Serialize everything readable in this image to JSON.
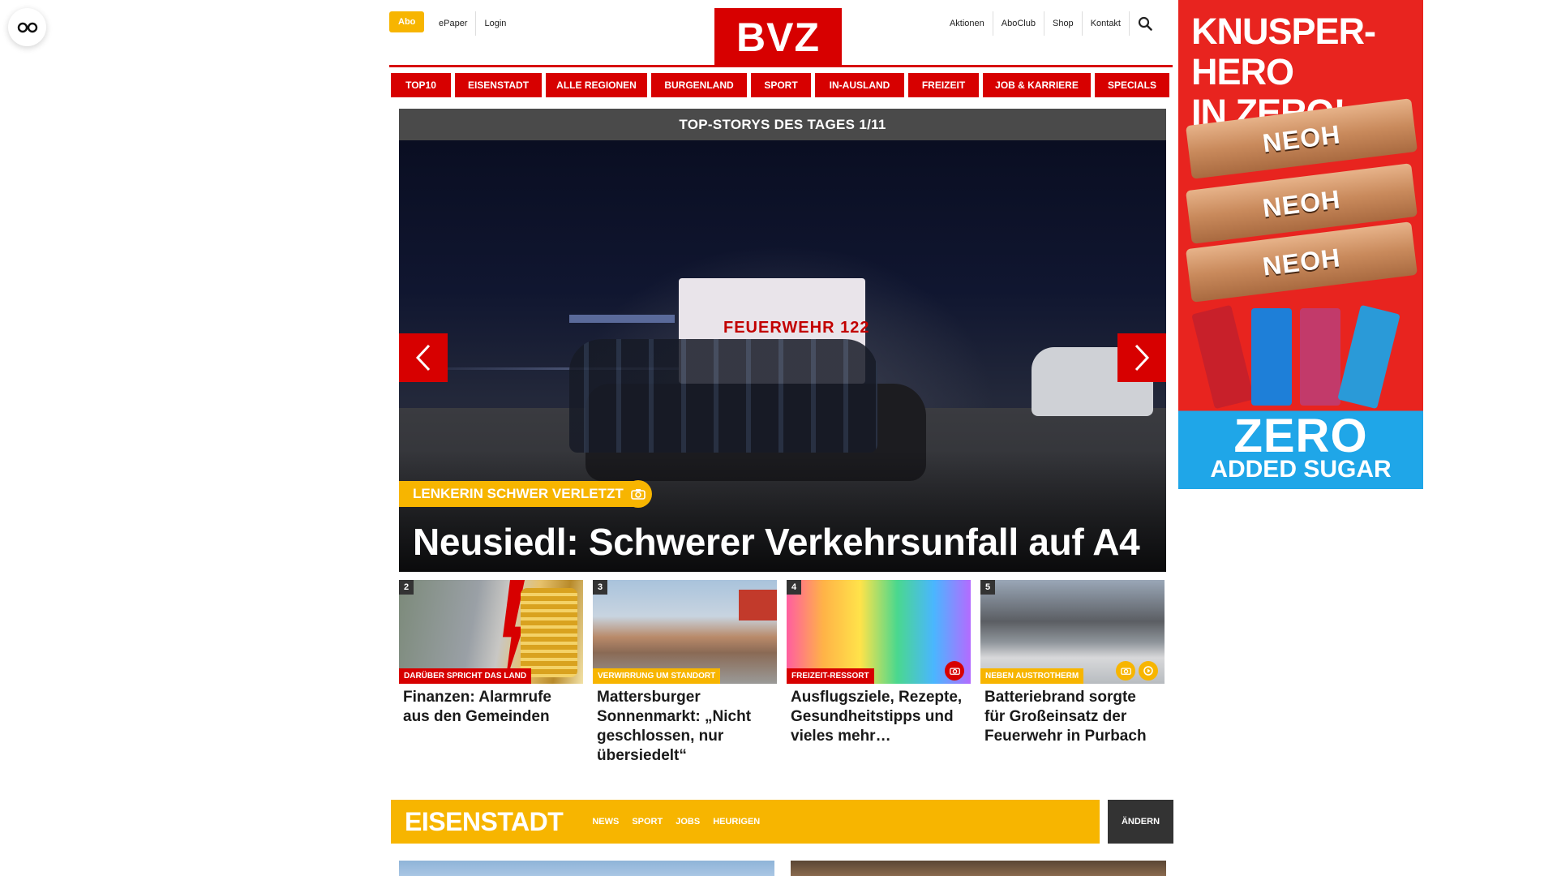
{
  "meta_nav": {
    "abo_label": "Abo",
    "left_links": [
      "ePaper",
      "Login"
    ],
    "right_links": [
      "Aktionen",
      "AboClub",
      "Shop",
      "Kontakt"
    ]
  },
  "logo": {
    "text": "BVZ"
  },
  "main_nav": [
    "TOP10",
    "EISENSTADT",
    "ALLE REGIONEN",
    "BURGENLAND",
    "SPORT",
    "IN-AUSLAND",
    "FREIZEIT",
    "JOB & KARRIERE",
    "SPECIALS"
  ],
  "top_stories": {
    "header": "TOP-STORYS DES TAGES 1/11",
    "kicker": "LENKERIN SCHWER VERLETZT",
    "title": "Neusiedl: Schwerer Verkehrsunfall auf A4",
    "truck_text": "FEUERWEHR 122"
  },
  "teasers": [
    {
      "number": "2",
      "kicker": "DARÜBER SPRICHT DAS LAND",
      "kicker_color": "#d70000",
      "title": "Finanzen: Alarmrufe aus den Gemeinden"
    },
    {
      "number": "3",
      "kicker": "VERWIRRUNG UM STANDORT",
      "kicker_color": "#f7b500",
      "title": "Mattersburger Sonnenmarkt: „Nicht geschlossen, nur übersiedelt“"
    },
    {
      "number": "4",
      "kicker": "FREIZEIT-RESSORT",
      "kicker_color": "#d70000",
      "title": "Ausflugsziele, Rezepte, Gesundheitstipps und vieles mehr…"
    },
    {
      "number": "5",
      "kicker": "NEBEN AUSTROTHERM",
      "kicker_color": "#f7b500",
      "title": "Batteriebrand sorgte für Großeinsatz der Feuerwehr in Purbach"
    }
  ],
  "region": {
    "title": "EISENSTADT",
    "links": [
      "NEWS",
      "SPORT",
      "JOBS",
      "HEURIGEN"
    ],
    "change_label": "ÄNDERN"
  },
  "ad": {
    "headline_line1": "KNUSPER-HERO",
    "headline_line2": "IN ZERO!",
    "brand": "NEOH",
    "zero": "ZERO",
    "sugar": "ADDED SUGAR"
  },
  "colors": {
    "brand_red": "#d70000",
    "accent_yellow": "#f7b500",
    "dark": "#333333"
  },
  "icons": [
    "accessibility-glasses-icon",
    "search-icon",
    "chevron-left-icon",
    "chevron-right-icon",
    "camera-icon",
    "video-icon"
  ]
}
